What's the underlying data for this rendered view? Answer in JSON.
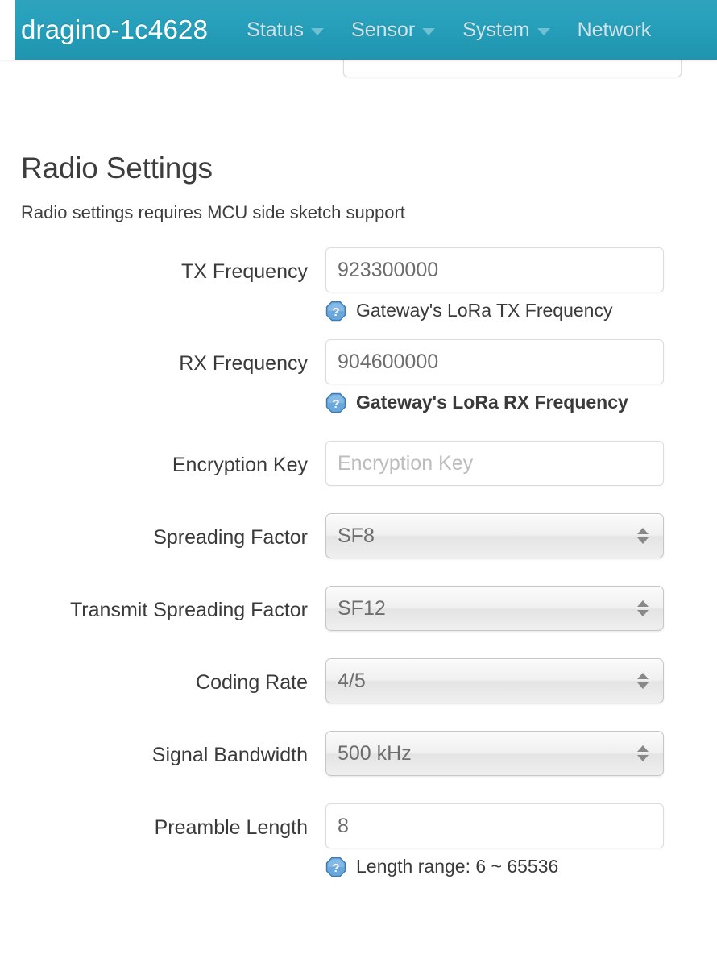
{
  "navbar": {
    "brand": "dragino-1c4628",
    "items": [
      {
        "label": "Status",
        "has_caret": true
      },
      {
        "label": "Sensor",
        "has_caret": true
      },
      {
        "label": "System",
        "has_caret": true
      },
      {
        "label": "Network",
        "has_caret": false
      }
    ],
    "bg_top": "#2fa3bd",
    "bg_bottom": "#1f94ae",
    "brand_color": "#ffffff",
    "item_color": "#cfe3e9"
  },
  "section": {
    "title": "Radio Settings",
    "description": "Radio settings requires MCU side sketch support"
  },
  "fields": {
    "tx_frequency": {
      "label": "TX Frequency",
      "value": "923300000",
      "placeholder": "",
      "hint": "Gateway's LoRa TX Frequency",
      "hint_icon": "help-icon"
    },
    "rx_frequency": {
      "label": "RX Frequency",
      "value": "904600000",
      "placeholder": "",
      "hint": "Gateway's LoRa RX Frequency",
      "hint_icon": "help-icon"
    },
    "encryption_key": {
      "label": "Encryption Key",
      "value": "",
      "placeholder": "Encryption Key"
    },
    "spreading_factor": {
      "label": "Spreading Factor",
      "value": "SF8"
    },
    "transmit_spreading_factor": {
      "label": "Transmit Spreading Factor",
      "value": "SF12"
    },
    "coding_rate": {
      "label": "Coding Rate",
      "value": "4/5"
    },
    "signal_bandwidth": {
      "label": "Signal Bandwidth",
      "value": "500 kHz"
    },
    "preamble_length": {
      "label": "Preamble Length",
      "value": "8",
      "placeholder": "",
      "hint": "Length range: 6 ~ 65536",
      "hint_icon": "help-icon"
    }
  },
  "colors": {
    "accent_teal": "#27a0bb",
    "help_icon_blue": "#5a9fd4",
    "label_text": "#3a3a3a",
    "field_text": "#6d6d6d",
    "placeholder_text": "#bdbdbd"
  }
}
